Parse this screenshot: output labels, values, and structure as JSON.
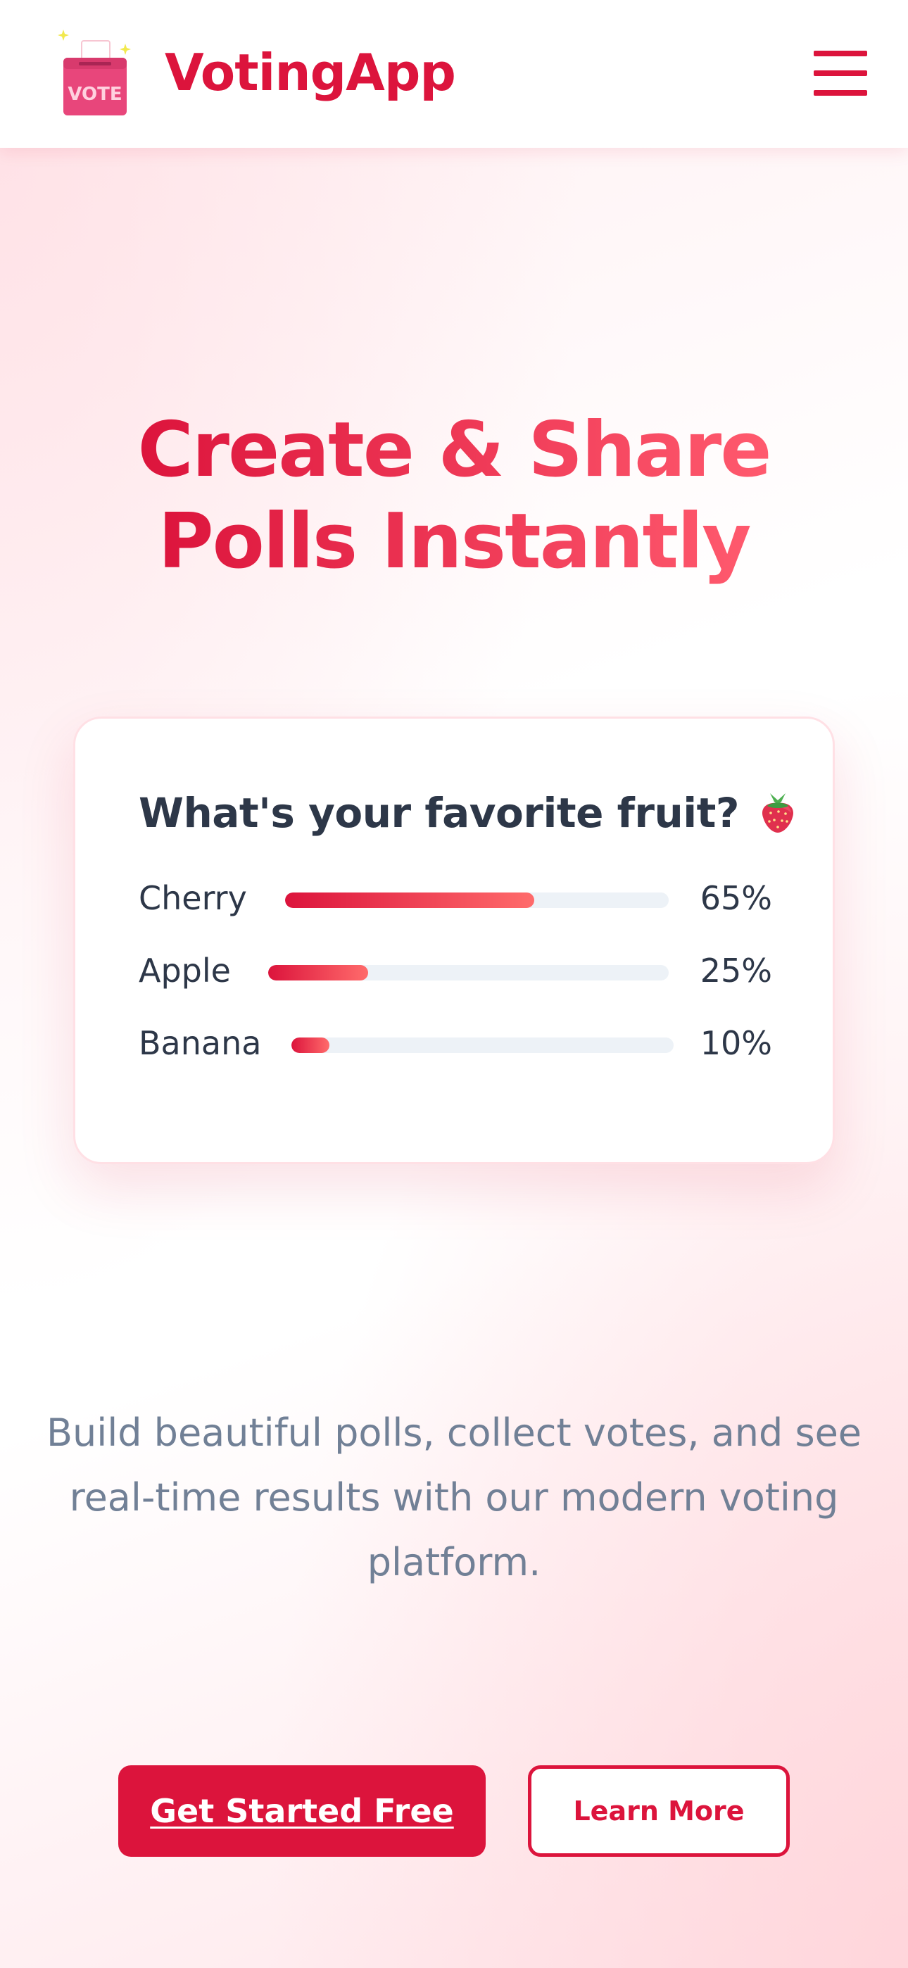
{
  "header": {
    "logo_icon": "ballot-box-icon",
    "logo_text": "VOTE",
    "brand_name": "VotingApp",
    "menu_icon": "hamburger-menu-icon"
  },
  "hero": {
    "title_line_1": "Create & Share",
    "title_line_2": "Polls Instantly",
    "description": "Build beautiful polls, collect votes, and see real-time results with our modern voting platform."
  },
  "poll": {
    "question": "What's your favorite fruit?",
    "question_icon": "strawberry-icon",
    "options": [
      {
        "label": "Cherry",
        "percent_label": "65%",
        "value": 65
      },
      {
        "label": "Apple",
        "percent_label": "25%",
        "value": 25
      },
      {
        "label": "Banana",
        "percent_label": "10%",
        "value": 10
      }
    ]
  },
  "actions": {
    "primary_label": "Get Started Free",
    "secondary_label": "Learn More"
  },
  "colors": {
    "brand": "#dc143c",
    "brand_light": "#ff6b6b",
    "text_dark": "#2d3748",
    "text_muted": "#718096",
    "track": "#edf2f7"
  }
}
